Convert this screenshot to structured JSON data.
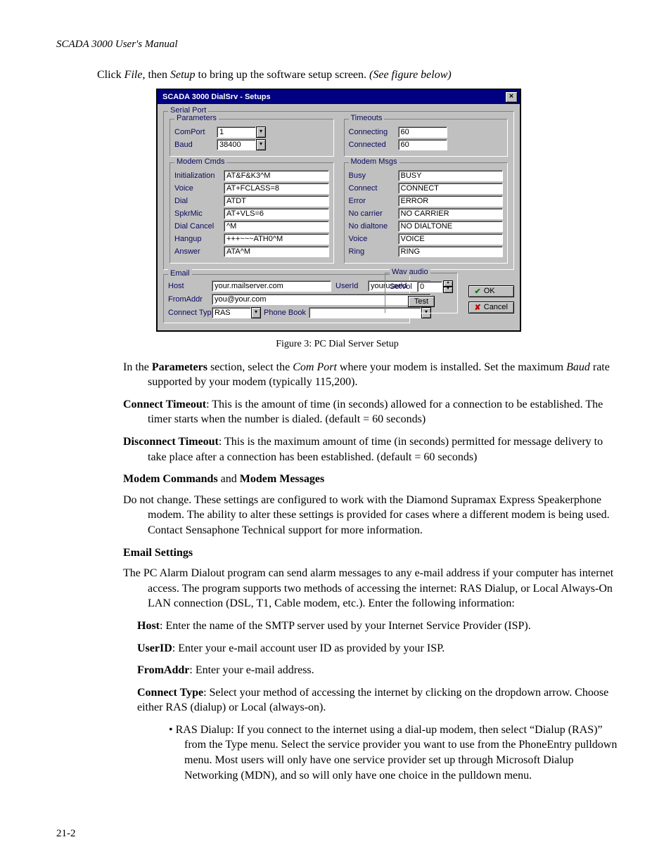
{
  "page": {
    "running_head": "SCADA 3000 User's Manual",
    "intro_line_html": "Click <i>File</i>, then <i>Setup</i> to bring up the software setup screen. <i>(See figure below)</i>",
    "figure_caption": "Figure 3: PC Dial Server Setup",
    "page_number": "21-2"
  },
  "dialog": {
    "title": "SCADA 3000 DialSrv - Setups",
    "serial_port": {
      "legend": "Serial Port",
      "parameters": {
        "legend": "Parameters",
        "comport_label": "ComPort",
        "comport_value": "1",
        "baud_label": "Baud",
        "baud_value": "38400"
      },
      "timeouts": {
        "legend": "Timeouts",
        "connecting_label": "Connecting",
        "connecting_value": "60",
        "connected_label": "Connected",
        "connected_value": "60"
      },
      "modem_cmds": {
        "legend": "Modem Cmds",
        "rows": [
          {
            "label": "Initialization",
            "value": "AT&F&K3^M"
          },
          {
            "label": "Voice",
            "value": "AT+FCLASS=8"
          },
          {
            "label": "Dial",
            "value": "ATDT"
          },
          {
            "label": "SpkrMic",
            "value": "AT+VLS=6"
          },
          {
            "label": "Dial Cancel",
            "value": "^M"
          },
          {
            "label": "Hangup",
            "value": "+++~~~ATH0^M"
          },
          {
            "label": "Answer",
            "value": "ATA^M"
          }
        ]
      },
      "modem_msgs": {
        "legend": "Modem Msgs",
        "rows": [
          {
            "label": "Busy",
            "value": "BUSY"
          },
          {
            "label": "Connect",
            "value": "CONNECT"
          },
          {
            "label": "Error",
            "value": "ERROR"
          },
          {
            "label": "No carrier",
            "value": "NO CARRIER"
          },
          {
            "label": "No dialtone",
            "value": "NO DIALTONE"
          },
          {
            "label": "Voice",
            "value": "VOICE"
          },
          {
            "label": "Ring",
            "value": "RING"
          }
        ]
      }
    },
    "email": {
      "legend": "Email",
      "host_label": "Host",
      "host_value": "your.mailserver.com",
      "userid_label": "UserId",
      "userid_value": "youruserid",
      "fromaddr_label": "FromAddr",
      "fromaddr_value": "you@your.com",
      "connecttype_label": "Connect Type",
      "connecttype_value": "RAS",
      "phonebook_label": "Phone Book",
      "phonebook_value": ""
    },
    "wav": {
      "legend": "Wav audio",
      "setvol_label": "SetVol",
      "setvol_value": "0",
      "test_label": "Test"
    },
    "ok_label": "OK",
    "cancel_label": "Cancel"
  },
  "body": {
    "p_params": "In the <b>Parameters</b> section, select the <i>Com Port</i> where your modem is installed.  Set the maximum <i>Baud</i> rate supported by your modem (typically 115,200).",
    "p_connect_to": "<b>Connect Timeout</b>:  This is the amount of time (in seconds) allowed for a connection to be established.  The timer starts when the number is dialed.  (default = 60 seconds)",
    "p_disconnect_to": "<b>Disconnect Timeout</b>:  This is the maximum amount of time (in seconds) permitted for message delivery to take place after a connection has been established.  (default = 60 seconds)",
    "h_modem": "<b>Modem Commands</b> and <b>Modem Messages</b>",
    "p_modem": "Do not change. These settings are configured to work with the Diamond Supramax Express Speakerphone modem. The ability to alter these settings is provided for cases where a different modem is being used. Contact Sensaphone Technical support for more information.",
    "h_email": "<b>Email Settings</b>",
    "p_email": "The PC Alarm Dialout program can send alarm messages to any e-mail address if your computer has internet access. The program supports two methods of accessing the internet: RAS Dialup, or Local Always-On LAN connection (DSL, T1, Cable modem, etc.). Enter the following information:",
    "p_host": "<b>Host</b>:  Enter the name of the SMTP server used by your Internet Service Provider (ISP).",
    "p_userid": "<b>UserID</b>: Enter your e-mail account user ID as provided by your ISP.",
    "p_fromaddr": "<b>FromAddr</b>: Enter your e-mail address.",
    "p_conntype": "<b>Connect Type</b>: Select your method of accessing the internet by clicking on the dropdown arrow.  Choose either RAS (dialup) or Local (always-on).",
    "p_ras": "• RAS Dialup: If you connect to the internet using a dial-up modem, then select “Dialup (RAS)” from the Type menu. Select the service provider you want to use from the PhoneEntry pulldown menu. Most users will only have one service provider set up through Microsoft Dialup Networking (MDN), and so will only have one choice in the pulldown menu."
  }
}
